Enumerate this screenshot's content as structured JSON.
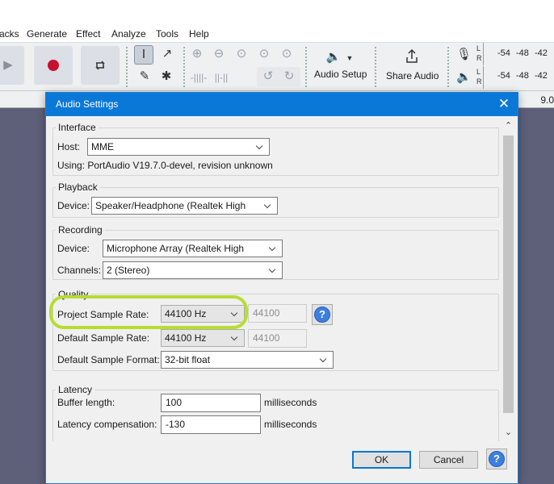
{
  "menubar": {
    "items": [
      "acks",
      "Generate",
      "Effect",
      "Analyze",
      "Tools",
      "Help"
    ]
  },
  "toolbar": {
    "audio_setup_label": "Audio Setup",
    "share_audio_label": "Share Audio",
    "meter_ticks": [
      "-54",
      "-48",
      "-42"
    ],
    "meter_channels": [
      "L",
      "R"
    ]
  },
  "ruler": {
    "visible_label": "9.0"
  },
  "dialog": {
    "title": "Audio Settings",
    "interface": {
      "title": "Interface",
      "host_label": "Host:",
      "host_value": "MME",
      "using_text": "Using: PortAudio V19.7.0-devel, revision unknown"
    },
    "playback": {
      "title": "Playback",
      "device_label": "Device:",
      "device_value": "Speaker/Headphone (Realtek High"
    },
    "recording": {
      "title": "Recording",
      "device_label": "Device:",
      "device_value": "Microphone Array (Realtek High",
      "channels_label": "Channels:",
      "channels_value": "2 (Stereo)"
    },
    "quality": {
      "title": "Quality",
      "project_rate_label": "Project Sample Rate:",
      "project_rate_value": "44100 Hz",
      "project_rate_custom": "44100",
      "default_rate_label": "Default Sample Rate:",
      "default_rate_value": "44100 Hz",
      "default_rate_custom": "44100",
      "default_format_label": "Default Sample Format:",
      "default_format_value": "32-bit float",
      "help_glyph": "?"
    },
    "latency": {
      "title": "Latency",
      "buffer_label": "Buffer length:",
      "buffer_value": "100",
      "buffer_unit": "milliseconds",
      "comp_label": "Latency compensation:",
      "comp_value": "-130",
      "comp_unit": "milliseconds"
    },
    "buttons": {
      "ok": "OK",
      "cancel": "Cancel",
      "help": "?"
    },
    "highlight_color": "#b9dc32",
    "accent_color": "#0a78d7"
  },
  "icons": {
    "play": "play-icon",
    "record": "record-icon",
    "loop": "loop-icon",
    "select_tool": "select-tool-icon",
    "envelope_tool": "envelope-tool-icon",
    "draw_tool": "draw-tool-icon",
    "multi_tool": "multi-tool-icon",
    "zoom_in": "zoom-in-icon",
    "zoom_out": "zoom-out-icon",
    "speaker": "speaker-icon",
    "share": "share-icon",
    "mic": "microphone-icon"
  }
}
